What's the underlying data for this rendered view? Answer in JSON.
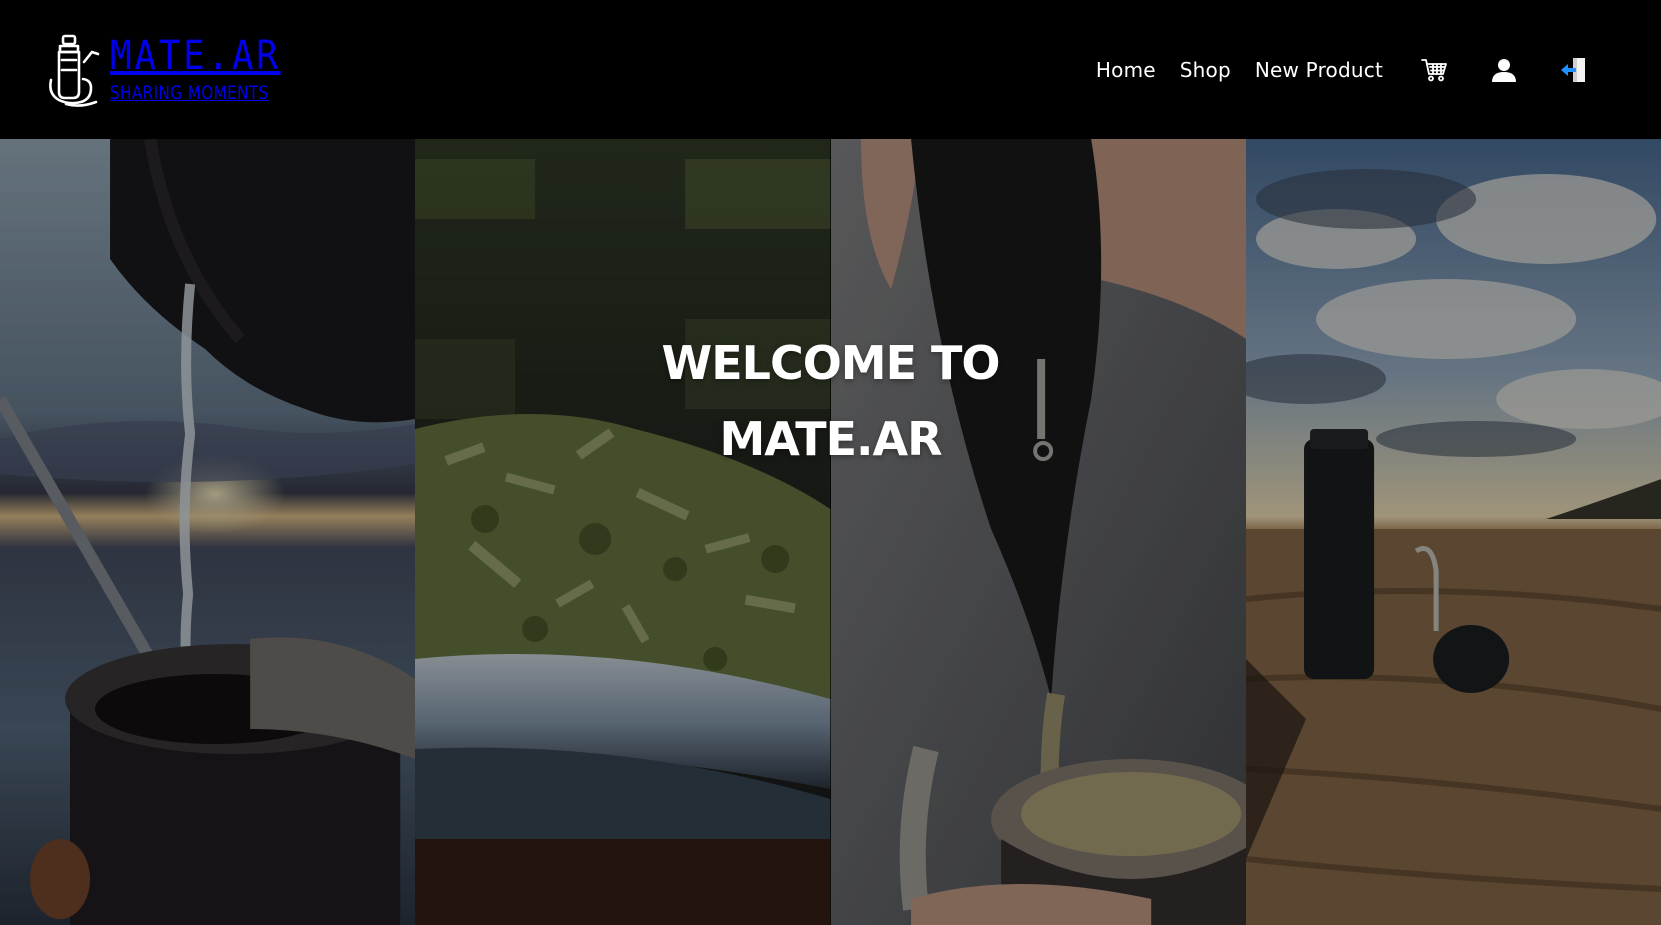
{
  "brand": {
    "title": "MATE.AR",
    "subtitle": "SHARING MOMENTS"
  },
  "nav": {
    "items": [
      {
        "label": "Home"
      },
      {
        "label": "Shop"
      },
      {
        "label": "New Product"
      }
    ],
    "icons": [
      "cart-icon",
      "user-icon",
      "logout-icon"
    ]
  },
  "hero": {
    "title_line1": "WELCOME TO",
    "title_line2": "MATE.AR"
  },
  "colors": {
    "navbar_bg": "#000000",
    "text": "#ffffff",
    "logout_accent": "#1e90ff"
  }
}
